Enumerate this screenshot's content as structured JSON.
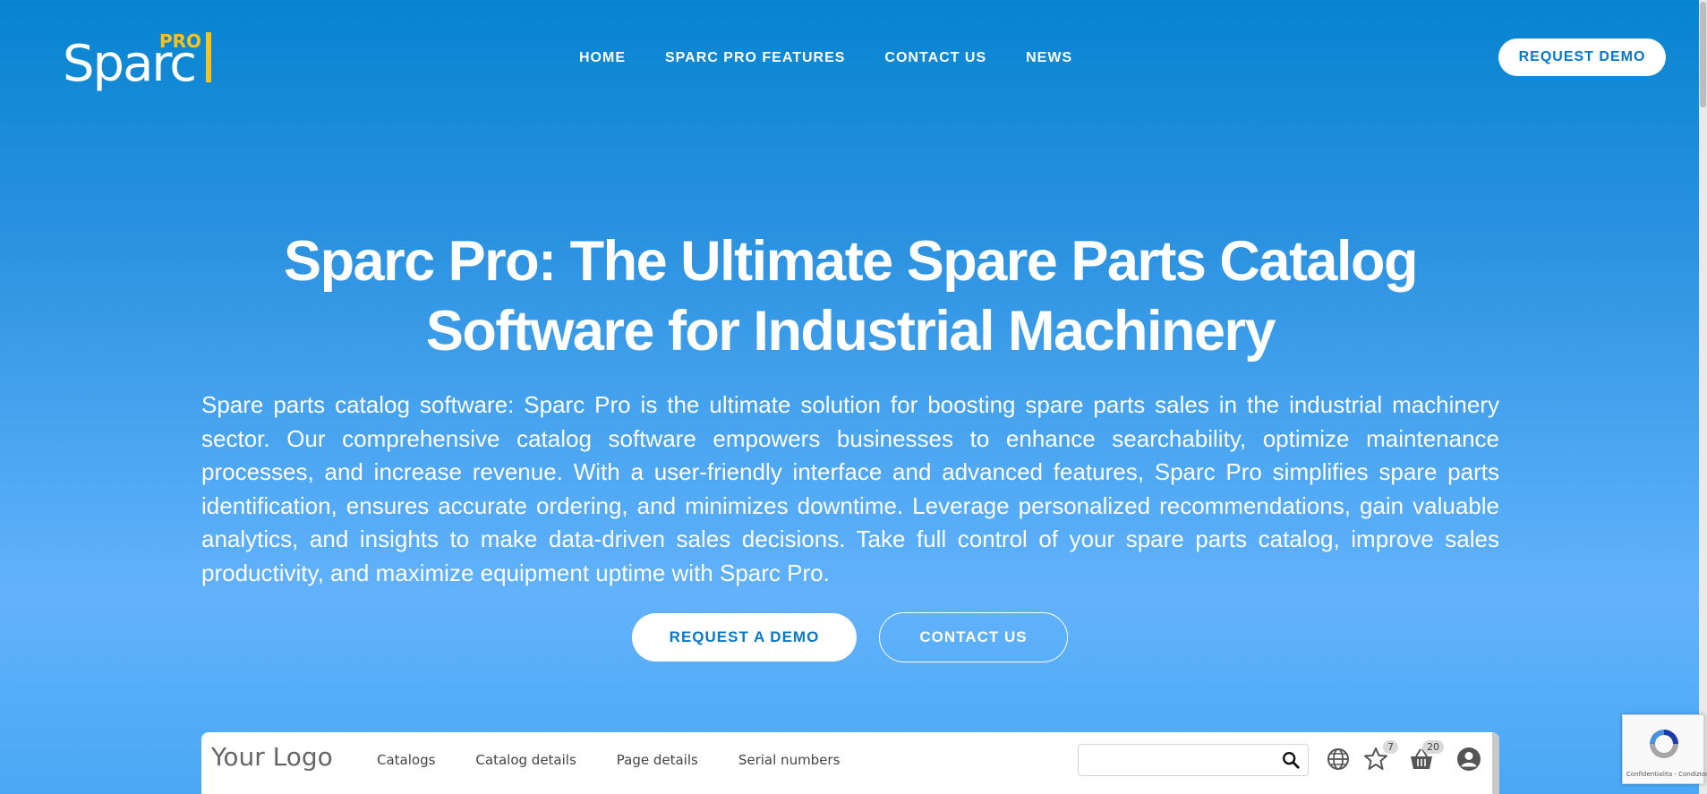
{
  "header": {
    "logo": {
      "word": "Sparc",
      "pro": "PRO"
    },
    "nav": [
      "HOME",
      "SPARC PRO FEATURES",
      "CONTACT US",
      "NEWS"
    ],
    "cta": "REQUEST DEMO"
  },
  "hero": {
    "title_line1": "Sparc Pro: The Ultimate Spare Parts Catalog",
    "title_line2": "Software for Industrial Machinery",
    "description": "Spare parts catalog software: Sparc Pro is the ultimate solution for boosting spare parts sales in the industrial machinery sector. Our comprehensive catalog software empowers businesses to enhance searchability, optimize maintenance processes, and increase revenue. With a user-friendly interface and advanced features, Sparc Pro simplifies spare parts identification, ensures accurate ordering, and minimizes downtime. Leverage personalized recommendations, gain valuable analytics, and insights to make data-driven sales decisions. Take full control of your spare parts catalog, improve sales productivity, and maximize equipment uptime with Sparc Pro.",
    "primary_cta": "REQUEST A DEMO",
    "secondary_cta": "CONTACT US"
  },
  "preview": {
    "logo": "Your Logo",
    "nav": [
      "Catalogs",
      "Catalog details",
      "Page details",
      "Serial numbers"
    ],
    "search_value": "",
    "favorites_count": "7",
    "cart_count": "20",
    "icons": [
      "search-icon",
      "globe-icon",
      "star-icon",
      "basket-icon",
      "user-icon"
    ]
  },
  "recaptcha": {
    "text": "Confidentialita - Condizioni"
  },
  "colors": {
    "brand_blue": "#0878c8",
    "accent_yellow": "#f6c21b",
    "background_top": "#0684d0",
    "background_bottom": "#62b2fb"
  }
}
